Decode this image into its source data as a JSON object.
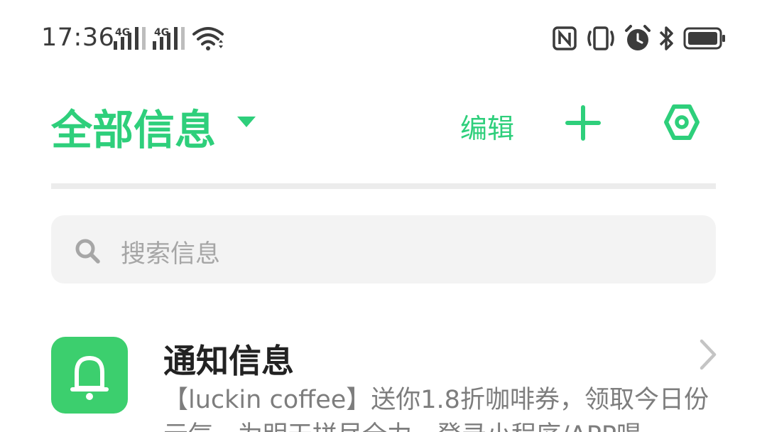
{
  "status_bar": {
    "time": "17:36",
    "signal_1_label": "4G",
    "signal_2_label": "4G",
    "icons": [
      "nfc-icon",
      "vibrate-icon",
      "alarm-icon",
      "bluetooth-icon",
      "battery-icon",
      "wifi-icon"
    ]
  },
  "header": {
    "title": "全部信息",
    "edit_label": "编辑"
  },
  "search": {
    "placeholder": "搜索信息"
  },
  "conversations": [
    {
      "title": "通知信息",
      "preview": "【luckin coffee】送你1.8折咖啡券，领取今日份元气，为明天拼尽全力，登录小程序/APP喝"
    }
  ],
  "colors": {
    "accent": "#2ecf7b",
    "icon_bg": "#3ccf6e",
    "status": "#3b3b3b"
  }
}
